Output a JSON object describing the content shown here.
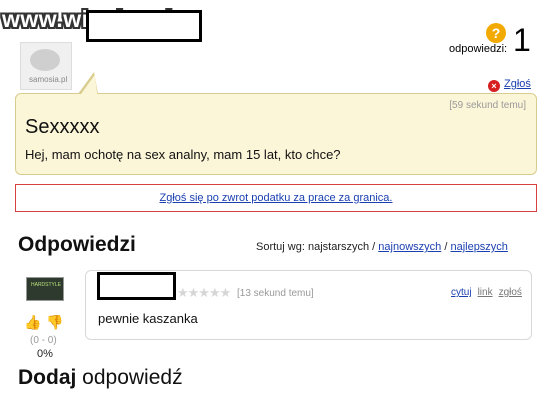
{
  "watermark": {
    "domain": "www.wiocha.pl"
  },
  "question_meta": {
    "count_label": "odpowiedzi:",
    "count": "1",
    "report": "Zgłoś",
    "avatar_text": "samosia.pl"
  },
  "question": {
    "time": "[59 sekund temu]",
    "title": "Sexxxxx",
    "body": "Hej, mam ochotę na sex analny, mam 15 lat, kto chce?"
  },
  "ad": {
    "text": "Zgłoś się po zwrot podatku za prace za granica."
  },
  "answers": {
    "title": "Odpowiedzi",
    "sort_label": "Sortuj wg: najstarszych /",
    "sort_newest": "najnowszych",
    "sort_separator": "/",
    "sort_best": "najlepszych"
  },
  "answer": {
    "avatar_text": "HARDSTYLE",
    "stars": "★★★★★",
    "time": "[13 sekund temu]",
    "quote": "cytuj",
    "link": "link",
    "report": "zgłoś",
    "body": "pewnie kaszanka",
    "votes": "(0 - 0)",
    "percent": "0%"
  },
  "add": {
    "bold": "Dodaj",
    "rest": " odpowiedź"
  }
}
